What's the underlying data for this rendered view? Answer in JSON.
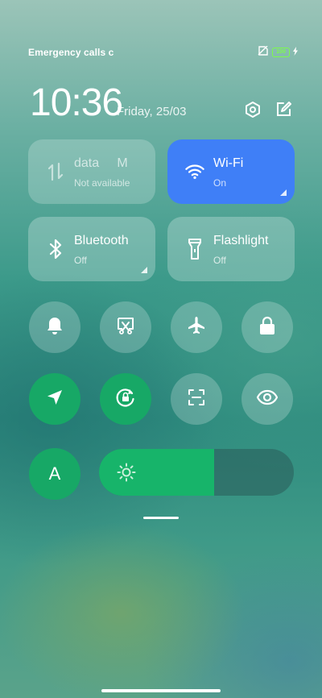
{
  "status_bar": {
    "left_text": "Emergency calls c",
    "battery_level": "100",
    "icons": [
      "no-sim-icon",
      "battery-icon",
      "charging-icon"
    ]
  },
  "header": {
    "time": "10:36",
    "date": "Friday, 25/03",
    "settings_icon": "settings-hex-icon",
    "edit_icon": "edit-icon"
  },
  "tiles": [
    {
      "title": "data     M",
      "subtitle": "Not available",
      "state": "disabled",
      "icon": "mobile-data-icon"
    },
    {
      "title": "Wi-Fi",
      "subtitle": "On",
      "state": "on",
      "icon": "wifi-icon"
    },
    {
      "title": "Bluetooth",
      "subtitle": "Off",
      "state": "off",
      "icon": "bluetooth-icon"
    },
    {
      "title": "Flashlight",
      "subtitle": "Off",
      "state": "off",
      "icon": "flashlight-icon"
    }
  ],
  "toggles_row1": [
    {
      "name": "bell-icon",
      "state": "off"
    },
    {
      "name": "screenshot-icon",
      "state": "off"
    },
    {
      "name": "airplane-icon",
      "state": "off"
    },
    {
      "name": "lock-icon",
      "state": "off"
    }
  ],
  "toggles_row2": [
    {
      "name": "location-icon",
      "state": "on"
    },
    {
      "name": "rotation-lock-icon",
      "state": "on"
    },
    {
      "name": "scanner-icon",
      "state": "off"
    },
    {
      "name": "eye-icon",
      "state": "off"
    }
  ],
  "auto_brightness": {
    "label": "A",
    "state": "on"
  },
  "brightness": {
    "level": 0.59
  },
  "colors": {
    "accent_blue": "#3f7ff7",
    "accent_green": "#17a866"
  }
}
